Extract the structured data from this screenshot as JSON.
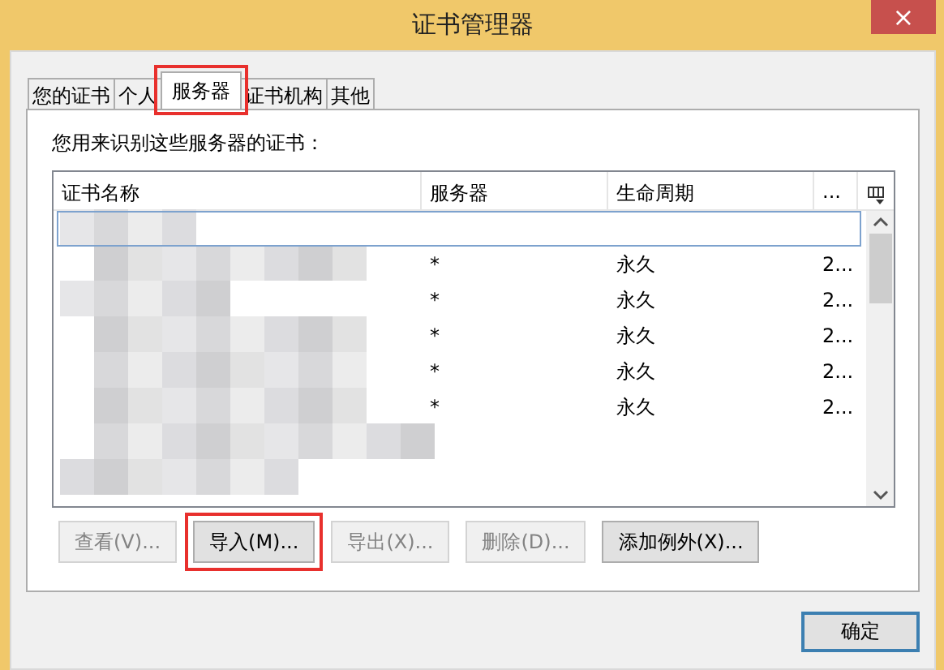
{
  "window": {
    "title": "证书管理器",
    "close": "×"
  },
  "tabs": [
    {
      "label": "您的证书",
      "selected": false,
      "highlighted": false
    },
    {
      "label": "个人",
      "selected": false,
      "highlighted": false
    },
    {
      "label": "服务器",
      "selected": true,
      "highlighted": true
    },
    {
      "label": "证书机构",
      "selected": false,
      "highlighted": false
    },
    {
      "label": "其他",
      "selected": false,
      "highlighted": false
    }
  ],
  "description": "您用来识别这些服务器的证书：",
  "table": {
    "columns": [
      "证书名称",
      "服务器",
      "生命周期",
      "..."
    ],
    "rows": [
      {
        "cells": [
          "",
          "",
          "",
          ""
        ],
        "selected": true
      },
      {
        "cells": [
          "",
          "*",
          "永久",
          "2..."
        ],
        "selected": false
      },
      {
        "cells": [
          "",
          "*",
          "永久",
          "2..."
        ],
        "selected": false
      },
      {
        "cells": [
          "",
          "*",
          "永久",
          "2..."
        ],
        "selected": false
      },
      {
        "cells": [
          "",
          "*",
          "永久",
          "2..."
        ],
        "selected": false
      },
      {
        "cells": [
          "",
          "*",
          "永久",
          "2..."
        ],
        "selected": false
      }
    ]
  },
  "buttons": [
    {
      "label": "查看(V)...",
      "disabled": true,
      "highlighted": false
    },
    {
      "label": "导入(M)...",
      "disabled": false,
      "highlighted": true
    },
    {
      "label": "导出(X)...",
      "disabled": true,
      "highlighted": false
    },
    {
      "label": "删除(D)...",
      "disabled": true,
      "highlighted": false
    },
    {
      "label": "添加例外(X)...",
      "disabled": false,
      "highlighted": false
    }
  ],
  "ok_button": {
    "label": "确定",
    "default": true
  }
}
